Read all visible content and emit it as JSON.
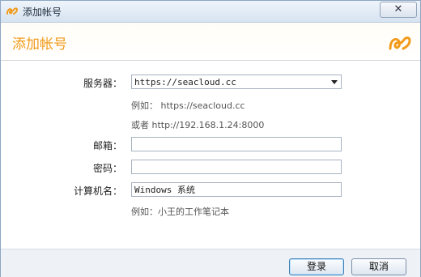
{
  "window": {
    "title": "添加帐号",
    "close_glyph": "✕"
  },
  "header": {
    "title": "添加帐号",
    "brand_color": "#f29a1a"
  },
  "form": {
    "server": {
      "label": "服务器：",
      "value": "https://seacloud.cc",
      "example": "例如： https://seacloud.cc",
      "alt_example": "或者 http://192.168.1.24:8000"
    },
    "email": {
      "label": "邮箱：",
      "value": ""
    },
    "password": {
      "label": "密码：",
      "value": ""
    },
    "computer_name": {
      "label": "计算机名：",
      "value": "Windows 系统",
      "example": "例如：小王的工作笔记本"
    }
  },
  "buttons": {
    "login": "登录",
    "cancel": "取消"
  },
  "icons": {
    "app": "seafile-logo-icon",
    "close": "close-icon",
    "dropdown": "chevron-down-icon"
  }
}
